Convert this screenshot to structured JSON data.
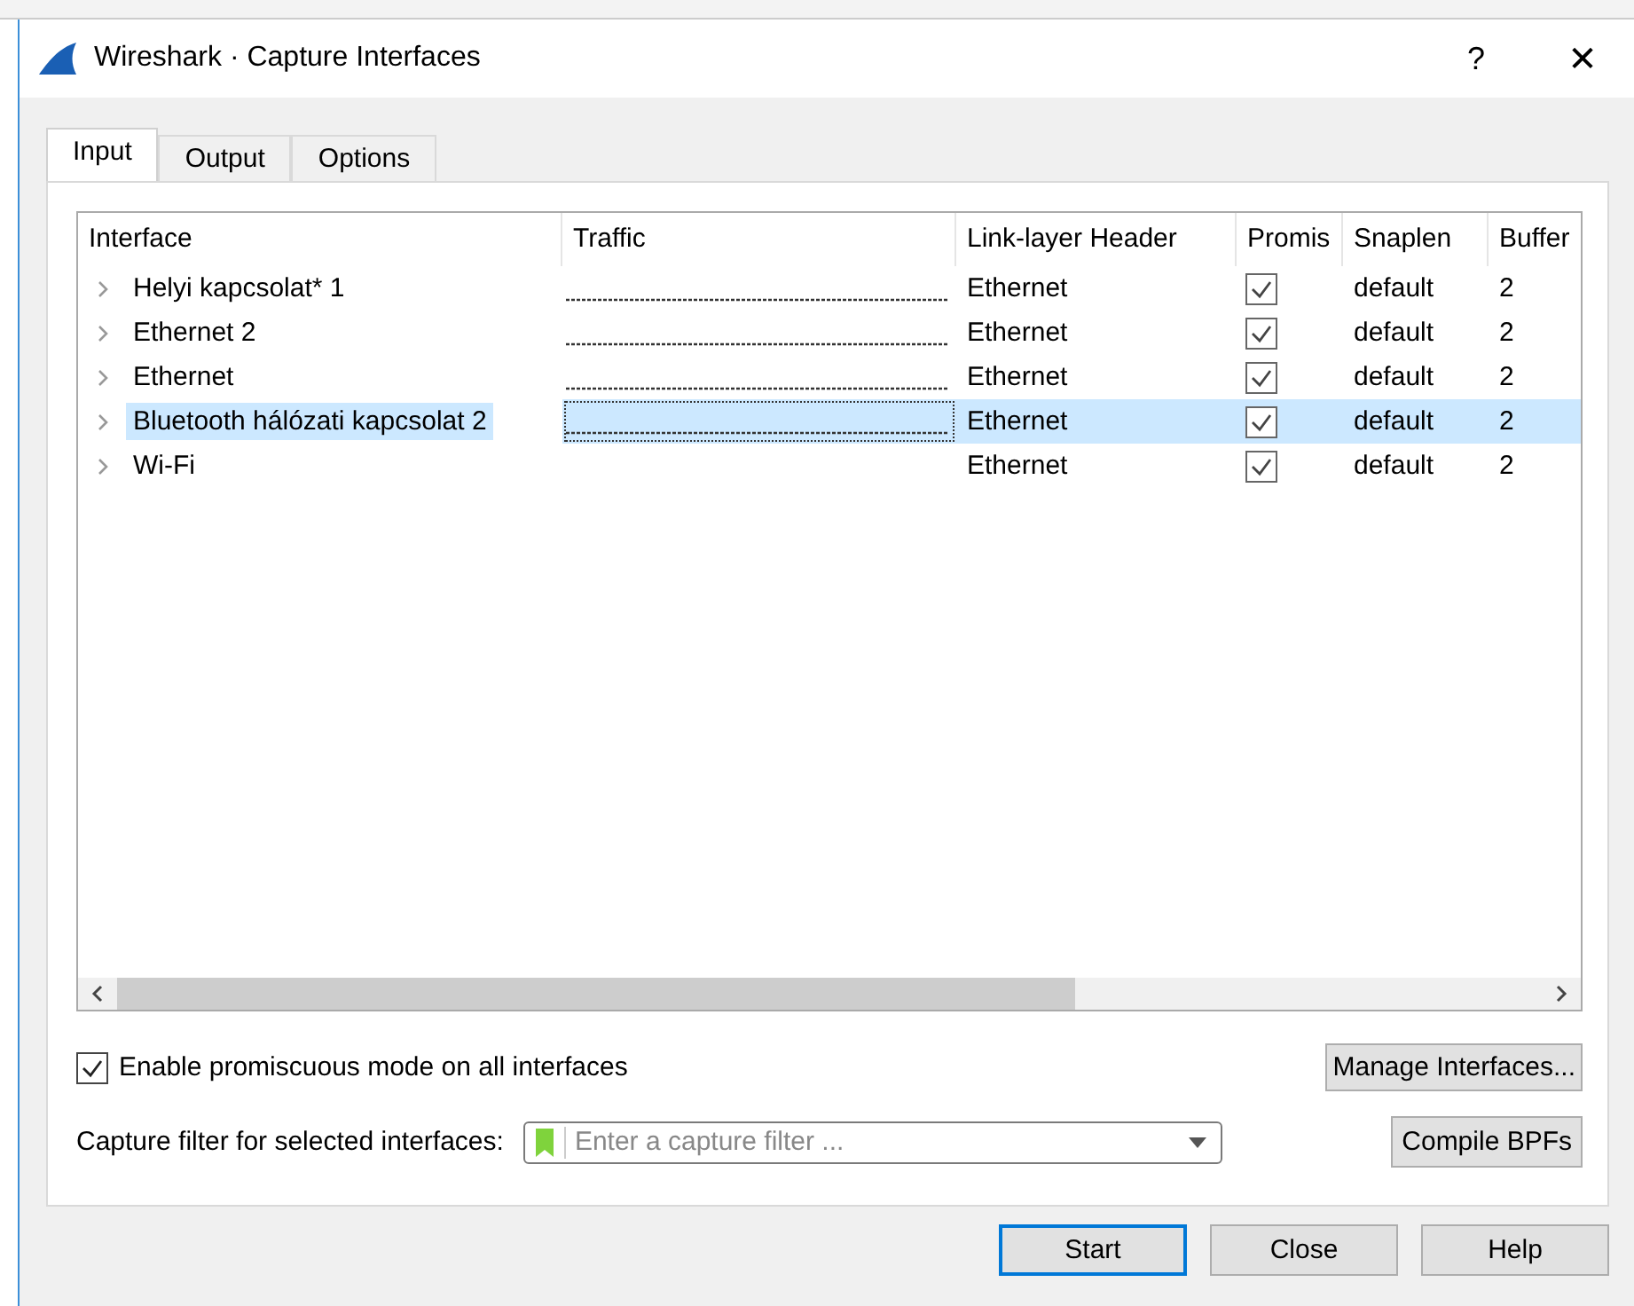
{
  "window": {
    "title": "Wireshark · Capture Interfaces",
    "help": "?",
    "close": "✕"
  },
  "tabs": [
    {
      "label": "Input",
      "selected": true
    },
    {
      "label": "Output",
      "selected": false
    },
    {
      "label": "Options",
      "selected": false
    }
  ],
  "table": {
    "columns": [
      "Interface",
      "Traffic",
      "Link-layer Header",
      "Promis",
      "Snaplen",
      "Buffer"
    ],
    "rows": [
      {
        "interface": "Helyi kapcsolat* 1",
        "has_traffic": true,
        "link": "Ethernet",
        "promiscuous": true,
        "snaplen": "default",
        "buffer": "2",
        "selected": false
      },
      {
        "interface": "Ethernet 2",
        "has_traffic": true,
        "link": "Ethernet",
        "promiscuous": true,
        "snaplen": "default",
        "buffer": "2",
        "selected": false
      },
      {
        "interface": "Ethernet",
        "has_traffic": true,
        "link": "Ethernet",
        "promiscuous": true,
        "snaplen": "default",
        "buffer": "2",
        "selected": false
      },
      {
        "interface": "Bluetooth hálózati kapcsolat 2",
        "has_traffic": true,
        "link": "Ethernet",
        "promiscuous": true,
        "snaplen": "default",
        "buffer": "2",
        "selected": true
      },
      {
        "interface": "Wi-Fi",
        "has_traffic": false,
        "link": "Ethernet",
        "promiscuous": true,
        "snaplen": "default",
        "buffer": "2",
        "selected": false
      }
    ]
  },
  "promiscuous_all": {
    "label": "Enable promiscuous mode on all interfaces",
    "checked": true
  },
  "manage_button": "Manage Interfaces...",
  "filter": {
    "label": "Capture filter for selected interfaces:",
    "placeholder": "Enter a capture filter ..."
  },
  "compile_button": "Compile BPFs",
  "buttons": [
    "Start",
    "Close",
    "Help"
  ]
}
